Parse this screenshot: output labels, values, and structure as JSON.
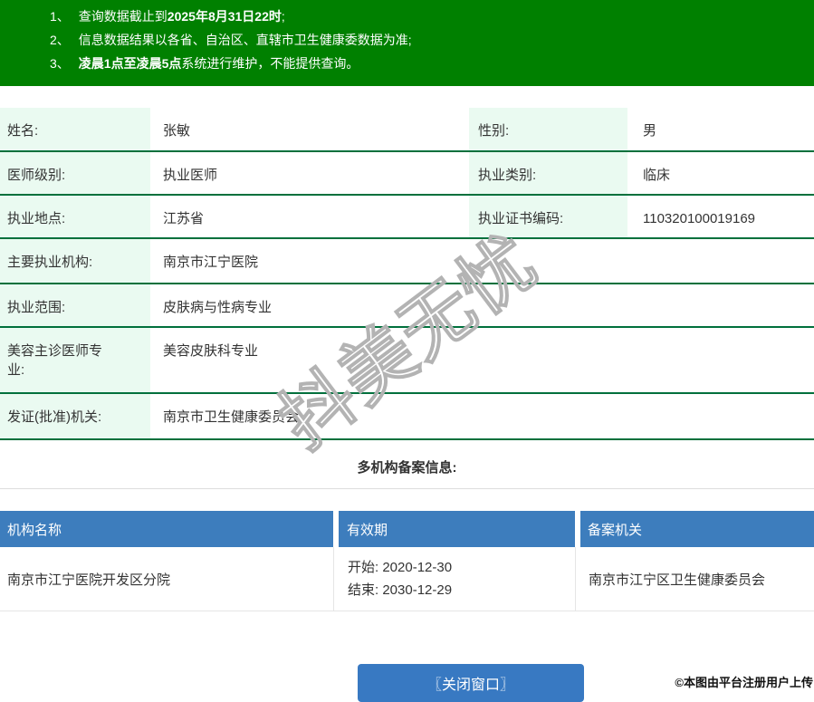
{
  "notice": {
    "lines": [
      {
        "num": "1、",
        "pre": "查询数据截止到",
        "bold": "2025年8月31日22时",
        "post": ";"
      },
      {
        "num": "2、",
        "pre": "信息数据结果以各省、自治区、直辖市卫生健康委数据为准;",
        "bold": "",
        "post": ""
      },
      {
        "num": "3、",
        "pre": "",
        "bold": "凌晨1点至凌晨5点",
        "post": "系统进行维护，不能提供查询。"
      }
    ]
  },
  "doctor_info": {
    "rows": [
      {
        "label": "姓名:",
        "value": "张敏",
        "label2": "性别:",
        "value2": "男"
      },
      {
        "label": "医师级别:",
        "value": "执业医师",
        "label2": "执业类别:",
        "value2": "临床"
      },
      {
        "label": "执业地点:",
        "value": "江苏省",
        "label2": "执业证书编码:",
        "value2": "110320100019169"
      },
      {
        "label": "主要执业机构:",
        "value": "南京市江宁医院"
      },
      {
        "label": "执业范围:",
        "value": "皮肤病与性病专业"
      },
      {
        "label": "美容主诊医师专业:",
        "value": "美容皮肤科专业"
      },
      {
        "label": "发证(批准)机关:",
        "value": "南京市卫生健康委员会"
      }
    ]
  },
  "filing": {
    "heading": "多机构备案信息:",
    "columns": {
      "name": "机构名称",
      "validity": "有效期",
      "authority": "备案机关"
    },
    "rows": [
      {
        "name": "南京市江宁医院开发区分院",
        "valid_from": "开始: 2020-12-30",
        "valid_to": "结束: 2030-12-29",
        "authority": "南京市江宁区卫生健康委员会"
      }
    ]
  },
  "footer": {
    "close_button": "〖关闭窗口〗",
    "credit": "©本图由平台注册用户上传"
  },
  "watermark": {
    "text": "抖美无忧"
  },
  "colors": {
    "banner_green": "#008000",
    "label_cell_bg": "#eafaf1",
    "row_border_green": "#00703c",
    "table_header_blue": "#3d7dbd",
    "button_blue": "#3879c2"
  }
}
